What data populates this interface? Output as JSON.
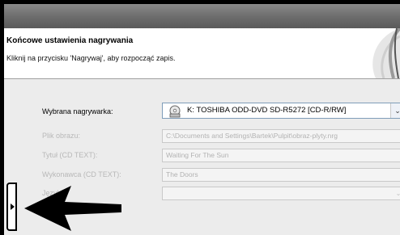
{
  "header": {
    "title": "Końcowe ustawienia nagrywania",
    "subtitle": "Kliknij na przycisku 'Nagrywaj', aby rozpocząć zapis."
  },
  "form": {
    "recorder_label": "Wybrana nagrywarka:",
    "recorder_value": "K: TOSHIBA ODD-DVD SD-R5272  [CD-R/RW]",
    "image_label": "Plik obrazu:",
    "image_value": "C:\\Documents and Settings\\Bartek\\Pulpit\\obraz-plyty.nrg",
    "title_label": "Tytuł (CD TEXT):",
    "title_value": "Waiting For The Sun",
    "artist_label": "Wykonawca (CD TEXT):",
    "artist_value": "The Doors",
    "language_label": "Język:"
  },
  "icons": {
    "recorder": "disc-drive-icon",
    "dropdown": "chevron-down-icon",
    "pointer": "black-arrow-annotation"
  }
}
